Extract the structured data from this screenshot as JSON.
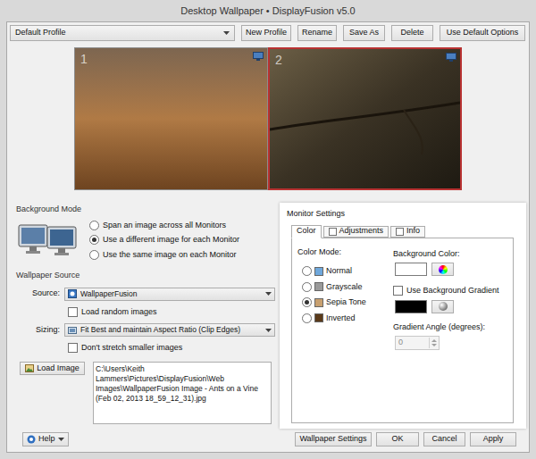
{
  "window": {
    "title": "Desktop Wallpaper • DisplayFusion v5.0"
  },
  "profile": {
    "value": "Default Profile",
    "buttons": [
      "New Profile",
      "Rename",
      "Save As",
      "Delete",
      "Use Default Options"
    ]
  },
  "monitors": [
    {
      "label": "1",
      "selected": false
    },
    {
      "label": "2",
      "selected": true
    }
  ],
  "background_mode": {
    "title": "Background Mode",
    "options": [
      {
        "label": "Span an image across all Monitors",
        "selected": false
      },
      {
        "label": "Use a different image for each Monitor",
        "selected": true
      },
      {
        "label": "Use the same image on each Monitor",
        "selected": false
      }
    ]
  },
  "wallpaper_source": {
    "title": "Wallpaper Source",
    "source": {
      "label": "Source:",
      "value": "WallpaperFusion"
    },
    "load_random": {
      "label": "Load random images",
      "checked": false
    },
    "sizing": {
      "label": "Sizing:",
      "value": "Fit Best and maintain Aspect Ratio (Clip Edges)"
    },
    "dont_stretch": {
      "label": "Don't stretch smaller images",
      "checked": false
    },
    "load_button": "Load Image",
    "path": "C:\\Users\\Keith Lammers\\Pictures\\DisplayFusion\\Web Images\\WallpaperFusion Image - Ants on a Vine (Feb 02, 2013 18_59_12_31).jpg"
  },
  "monitor_settings": {
    "title": "Monitor Settings",
    "tabs": [
      {
        "label": "Color",
        "selected": true,
        "kind": "plain",
        "checked": false
      },
      {
        "label": "Adjustments",
        "selected": false,
        "kind": "checkbox",
        "checked": false
      },
      {
        "label": "Info",
        "selected": false,
        "kind": "checkbox",
        "checked": false
      }
    ],
    "color_mode_label": "Color Mode:",
    "color_modes": [
      {
        "label": "Normal",
        "selected": false,
        "color": "#6fa8dc"
      },
      {
        "label": "Grayscale",
        "selected": false,
        "color": "#9a9a9a"
      },
      {
        "label": "Sepia Tone",
        "selected": true,
        "color": "#c8a070"
      },
      {
        "label": "Inverted",
        "selected": false,
        "color": "#5a3a1a"
      }
    ],
    "background_color_label": "Background Color:",
    "background_color": "#ffffff",
    "gradient": {
      "label": "Use Background Gradient",
      "checked": false
    },
    "gradient_color": "#000000",
    "angle_label": "Gradient Angle (degrees):",
    "angle": "0",
    "angle_disabled": true
  },
  "footer": {
    "help": "Help",
    "buttons": [
      "Wallpaper Settings",
      "OK",
      "Cancel",
      "Apply"
    ]
  }
}
